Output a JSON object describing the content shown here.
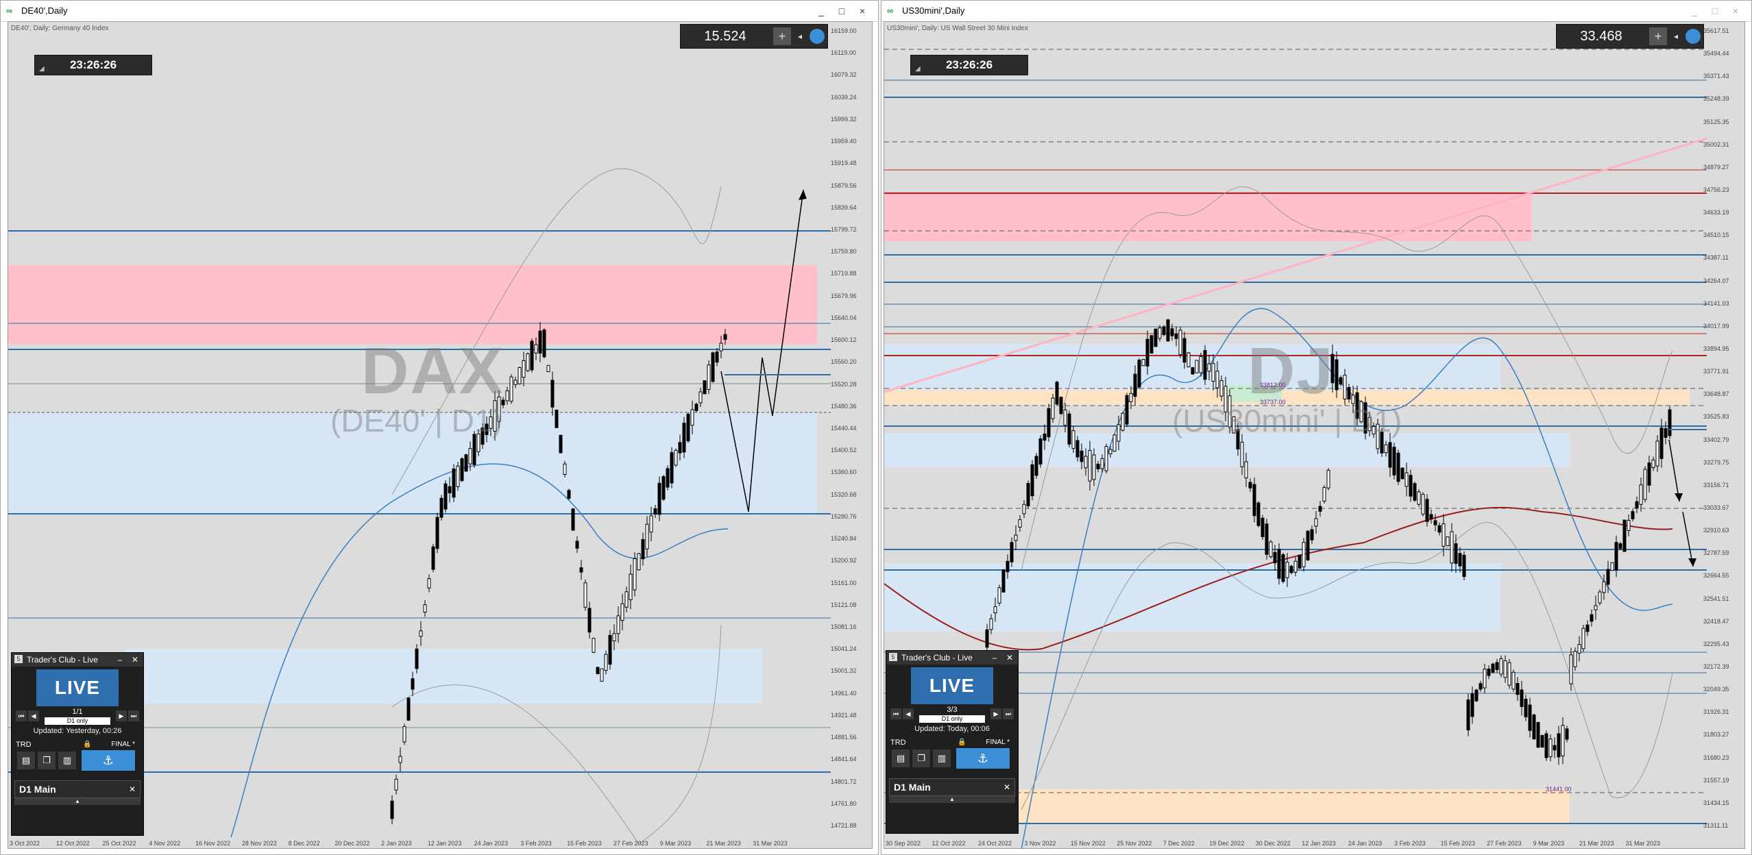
{
  "left_window": {
    "title": "DE40',Daily",
    "symbol_desc": "DE40', Daily:  Germany 40 Index",
    "clock": "23:26:26",
    "spread": "15.524",
    "watermark_main": "DAX",
    "watermark_sub": "(DE40' | D1)",
    "price_labels": [
      "16159.00",
      "16119.00",
      "16079.32",
      "16039.24",
      "15999.32",
      "15959.40",
      "15919.48",
      "15879.56",
      "15839.64",
      "15799.72",
      "15759.80",
      "15719.88",
      "15679.96",
      "15640.04",
      "15600.12",
      "15560.20",
      "15520.28",
      "15480.36",
      "15440.44",
      "15400.52",
      "15360.60",
      "15320.68",
      "15280.76",
      "15240.84",
      "15200.92",
      "15161.00",
      "15121.08",
      "15081.16",
      "15041.24",
      "15001.32",
      "14961.40",
      "14921.48",
      "14881.56",
      "14841.64",
      "14801.72",
      "14761.80",
      "14721.88"
    ],
    "date_labels": [
      "3 Oct 2022",
      "12 Oct 2022",
      "25 Oct 2022",
      "4 Nov 2022",
      "16 Nov 2022",
      "28 Nov 2022",
      "8 Dec 2022",
      "20 Dec 2022",
      "2 Jan 2023",
      "12 Jan 2023",
      "24 Jan 2023",
      "3 Feb 2023",
      "15 Feb 2023",
      "27 Feb 2023",
      "9 Mar 2023",
      "21 Mar 2023",
      "31 Mar 2023"
    ],
    "traders_club": {
      "header": "Trader's Club - Live",
      "logo": "LIVE",
      "count": "1/1",
      "filter": "D1 only",
      "updated": "Updated: Yesterday, 00:26",
      "trd": "TRD",
      "final": "FINAL *",
      "panel": "D1 Main"
    }
  },
  "right_window": {
    "title": "US30mini',Daily",
    "symbol_desc": "US30mini', Daily:  US Wall Street 30 Mini Index",
    "clock": "23:26:26",
    "spread": "33.468",
    "watermark_main": "DJ",
    "watermark_sub": "(US30mini' | D1)",
    "price_labels": [
      "35617.51",
      "35494.44",
      "35371.43",
      "35248.39",
      "35125.35",
      "35002.31",
      "34879.27",
      "34756.23",
      "34633.19",
      "34510.15",
      "34387.11",
      "34264.07",
      "34141.03",
      "34017.99",
      "33894.95",
      "33771.91",
      "33648.87",
      "33525.83",
      "33402.79",
      "33279.75",
      "33156.71",
      "33033.67",
      "32910.63",
      "32787.59",
      "32664.55",
      "32541.51",
      "32418.47",
      "32295.43",
      "32172.39",
      "32049.35",
      "31926.31",
      "31803.27",
      "31680.23",
      "31557.19",
      "31434.15",
      "31311.11"
    ],
    "date_labels": [
      "30 Sep 2022",
      "12 Oct 2022",
      "24 Oct 2022",
      "3 Nov 2022",
      "15 Nov 2022",
      "25 Nov 2022",
      "7 Dec 2022",
      "19 Dec 2022",
      "30 Dec 2022",
      "12 Jan 2023",
      "24 Jan 2023",
      "3 Feb 2023",
      "15 Feb 2023",
      "27 Feb 2023",
      "9 Mar 2023",
      "21 Mar 2023",
      "31 Mar 2023"
    ],
    "level_labels": [
      "33812.00",
      "33737.00",
      "31441.00"
    ],
    "traders_club": {
      "header": "Trader's Club - Live",
      "logo": "LIVE",
      "count": "3/3",
      "filter": "D1 only",
      "updated": "Updated: Today, 00:06",
      "trd": "TRD",
      "final": "FINAL *",
      "panel": "D1 Main"
    }
  },
  "window_controls": {
    "minimize": "_",
    "maximize": "□",
    "close": "×"
  },
  "colors": {
    "chart_bg": "#dcdcdc",
    "supply_zone": "#ffc0cb",
    "demand_zone": "#d6e6f5",
    "level_blue": "#2e6da4",
    "level_red": "#b22222",
    "ma_blue": "#3a7fc1",
    "ma_red": "#9b1c1c"
  }
}
